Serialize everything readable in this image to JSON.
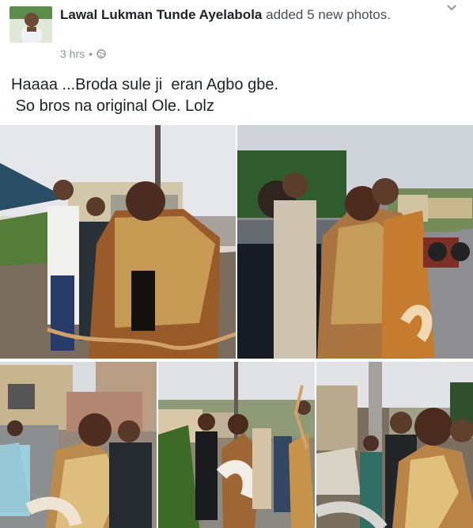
{
  "post": {
    "author": "Lawal Lukman Tunde Ayelabola",
    "action": "added 5 new photos.",
    "time": "3 hrs",
    "separator": "•",
    "privacy_icon": "globe-icon",
    "options_icon": "chevron-down-icon",
    "text": "Haaaa ...Broda sule ji  eran Agbo gbe.\n So bros na original Ole. Lolz"
  },
  "photos": [
    {
      "name": "photo-1"
    },
    {
      "name": "photo-2"
    },
    {
      "name": "photo-3"
    },
    {
      "name": "photo-4"
    },
    {
      "name": "photo-5"
    }
  ],
  "colors": {
    "text": "#1d2129",
    "secondary": "#90949c",
    "link": "#4b4f56"
  }
}
